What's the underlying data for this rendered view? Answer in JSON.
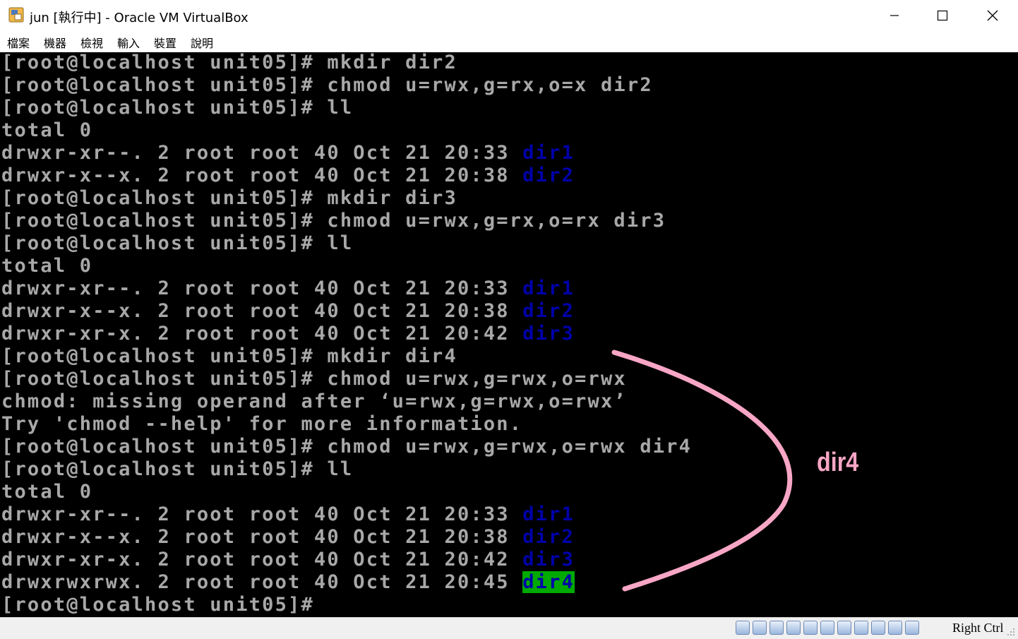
{
  "window": {
    "title": "jun [執行中] - Oracle VM VirtualBox",
    "icon": "virtualbox-app-icon",
    "controls": [
      "minimize-icon",
      "maximize-icon",
      "close-icon"
    ]
  },
  "menu": {
    "items": [
      "檔案",
      "機器",
      "檢視",
      "輸入",
      "裝置",
      "說明"
    ]
  },
  "terminal": {
    "colors": {
      "background": "#000000",
      "text": "#a8a8a8",
      "directory": "#0000aa",
      "highlight_bg": "#00aa00"
    },
    "lines": [
      {
        "segments": [
          {
            "text": "[root@localhost unit05]# mkdir dir2"
          }
        ]
      },
      {
        "segments": [
          {
            "text": "[root@localhost unit05]# chmod u=rwx,g=rx,o=x dir2"
          }
        ]
      },
      {
        "segments": [
          {
            "text": "[root@localhost unit05]# ll"
          }
        ]
      },
      {
        "segments": [
          {
            "text": "total 0"
          }
        ]
      },
      {
        "segments": [
          {
            "text": "drwxr-xr--. 2 root root 40 Oct 21 20:33 "
          },
          {
            "text": "dir1",
            "style": "blue"
          }
        ]
      },
      {
        "segments": [
          {
            "text": "drwxr-x--x. 2 root root 40 Oct 21 20:38 "
          },
          {
            "text": "dir2",
            "style": "blue"
          }
        ]
      },
      {
        "segments": [
          {
            "text": "[root@localhost unit05]# mkdir dir3"
          }
        ]
      },
      {
        "segments": [
          {
            "text": "[root@localhost unit05]# chmod u=rwx,g=rx,o=rx dir3"
          }
        ]
      },
      {
        "segments": [
          {
            "text": "[root@localhost unit05]# ll"
          }
        ]
      },
      {
        "segments": [
          {
            "text": "total 0"
          }
        ]
      },
      {
        "segments": [
          {
            "text": "drwxr-xr--. 2 root root 40 Oct 21 20:33 "
          },
          {
            "text": "dir1",
            "style": "blue"
          }
        ]
      },
      {
        "segments": [
          {
            "text": "drwxr-x--x. 2 root root 40 Oct 21 20:38 "
          },
          {
            "text": "dir2",
            "style": "blue"
          }
        ]
      },
      {
        "segments": [
          {
            "text": "drwxr-xr-x. 2 root root 40 Oct 21 20:42 "
          },
          {
            "text": "dir3",
            "style": "blue"
          }
        ]
      },
      {
        "segments": [
          {
            "text": "[root@localhost unit05]# mkdir dir4"
          }
        ]
      },
      {
        "segments": [
          {
            "text": "[root@localhost unit05]# chmod u=rwx,g=rwx,o=rwx"
          }
        ]
      },
      {
        "segments": [
          {
            "text": "chmod: missing operand after ‘u=rwx,g=rwx,o=rwx’"
          }
        ]
      },
      {
        "segments": [
          {
            "text": "Try 'chmod --help' for more information."
          }
        ]
      },
      {
        "segments": [
          {
            "text": "[root@localhost unit05]# chmod u=rwx,g=rwx,o=rwx dir4"
          }
        ]
      },
      {
        "segments": [
          {
            "text": "[root@localhost unit05]# ll"
          }
        ]
      },
      {
        "segments": [
          {
            "text": "total 0"
          }
        ]
      },
      {
        "segments": [
          {
            "text": "drwxr-xr--. 2 root root 40 Oct 21 20:33 "
          },
          {
            "text": "dir1",
            "style": "blue"
          }
        ]
      },
      {
        "segments": [
          {
            "text": "drwxr-x--x. 2 root root 40 Oct 21 20:38 "
          },
          {
            "text": "dir2",
            "style": "blue"
          }
        ]
      },
      {
        "segments": [
          {
            "text": "drwxr-xr-x. 2 root root 40 Oct 21 20:42 "
          },
          {
            "text": "dir3",
            "style": "blue"
          }
        ]
      },
      {
        "segments": [
          {
            "text": "drwxrwxrwx. 2 root root 40 Oct 21 20:45 "
          },
          {
            "text": "dir4",
            "style": "hl"
          }
        ]
      },
      {
        "segments": [
          {
            "text": "[root@localhost unit05]#"
          }
        ]
      }
    ]
  },
  "annotation": {
    "label": "dir4",
    "color": "#f8a6c6"
  },
  "statusbar": {
    "icons": [
      "hard-disk-icon",
      "optical-drive-icon",
      "audio-icon",
      "network-icon",
      "usb-icon",
      "shared-folders-icon",
      "display-icon",
      "recording-icon",
      "cpu-virtualization-icon",
      "mouse-integration-icon",
      "keyboard-capture-icon"
    ],
    "host_key": "Right Ctrl"
  }
}
